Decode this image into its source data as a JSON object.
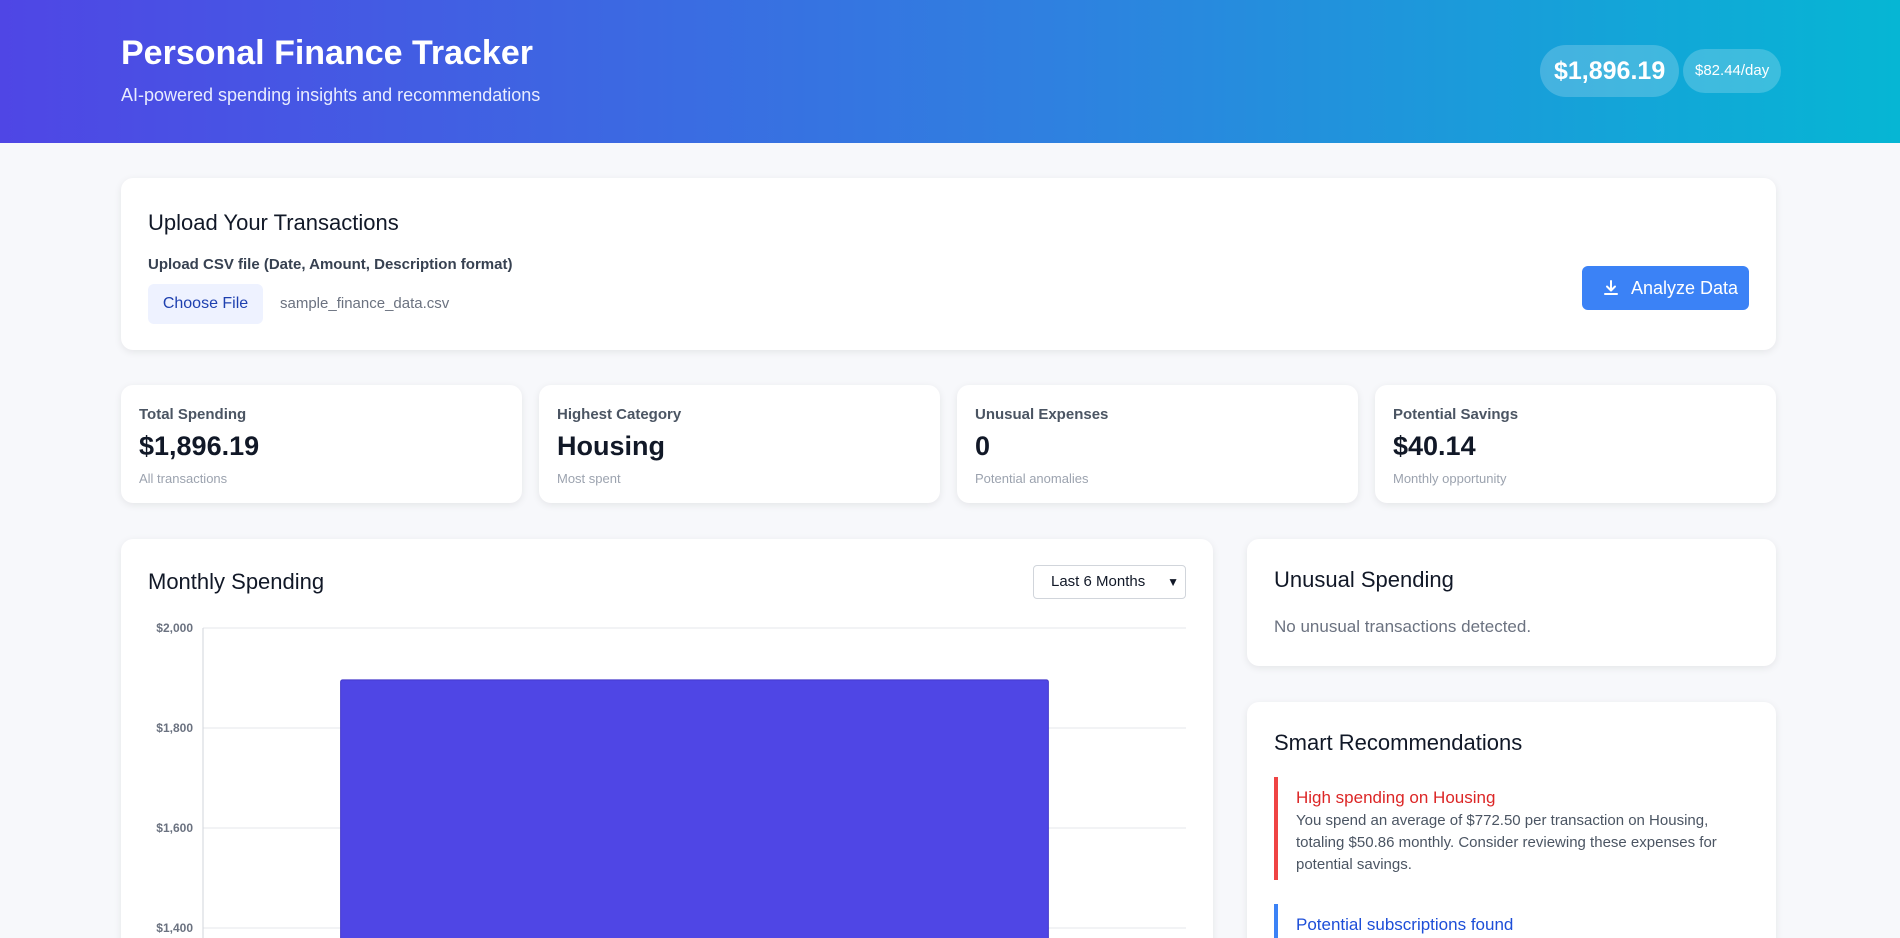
{
  "header": {
    "title": "Personal Finance Tracker",
    "subtitle": "AI-powered spending insights and recommendations",
    "total_badge": "$1,896.19",
    "per_day_badge": "$82.44/day"
  },
  "upload": {
    "heading": "Upload Your Transactions",
    "label": "Upload CSV file (Date, Amount, Description format)",
    "choose_button": "Choose File",
    "file_name": "sample_finance_data.csv",
    "analyze_button": "Analyze Data",
    "analyze_icon": "download-icon"
  },
  "stats": [
    {
      "label": "Total Spending",
      "value": "$1,896.19",
      "sub": "All transactions"
    },
    {
      "label": "Highest Category",
      "value": "Housing",
      "sub": "Most spent"
    },
    {
      "label": "Unusual Expenses",
      "value": "0",
      "sub": "Potential anomalies"
    },
    {
      "label": "Potential Savings",
      "value": "$40.14",
      "sub": "Monthly opportunity"
    }
  ],
  "monthly": {
    "heading": "Monthly Spending",
    "range_select": "Last 6 Months"
  },
  "chart_data": {
    "type": "bar",
    "categories": [
      ""
    ],
    "values": [
      1896.19
    ],
    "ylim": [
      1400,
      2000
    ],
    "yticks": [
      "$2,000",
      "$1,800",
      "$1,600",
      "$1,400"
    ],
    "bar_color": "#4f46e5",
    "grid": true
  },
  "unusual": {
    "heading": "Unusual Spending",
    "message": "No unusual transactions detected."
  },
  "recommendations": {
    "heading": "Smart Recommendations",
    "items": [
      {
        "title": "High spending on Housing",
        "description": "You spend an average of $772.50 per transaction on Housing, totaling $50.86 monthly. Consider reviewing these expenses for potential savings.",
        "color": "#ef4444"
      },
      {
        "title": "Potential subscriptions found",
        "color": "#3b82f6"
      }
    ]
  },
  "colors": {
    "header_gradient_start": "#4f46e5",
    "header_gradient_end": "#06b6d4",
    "accent": "#3b82f6"
  }
}
